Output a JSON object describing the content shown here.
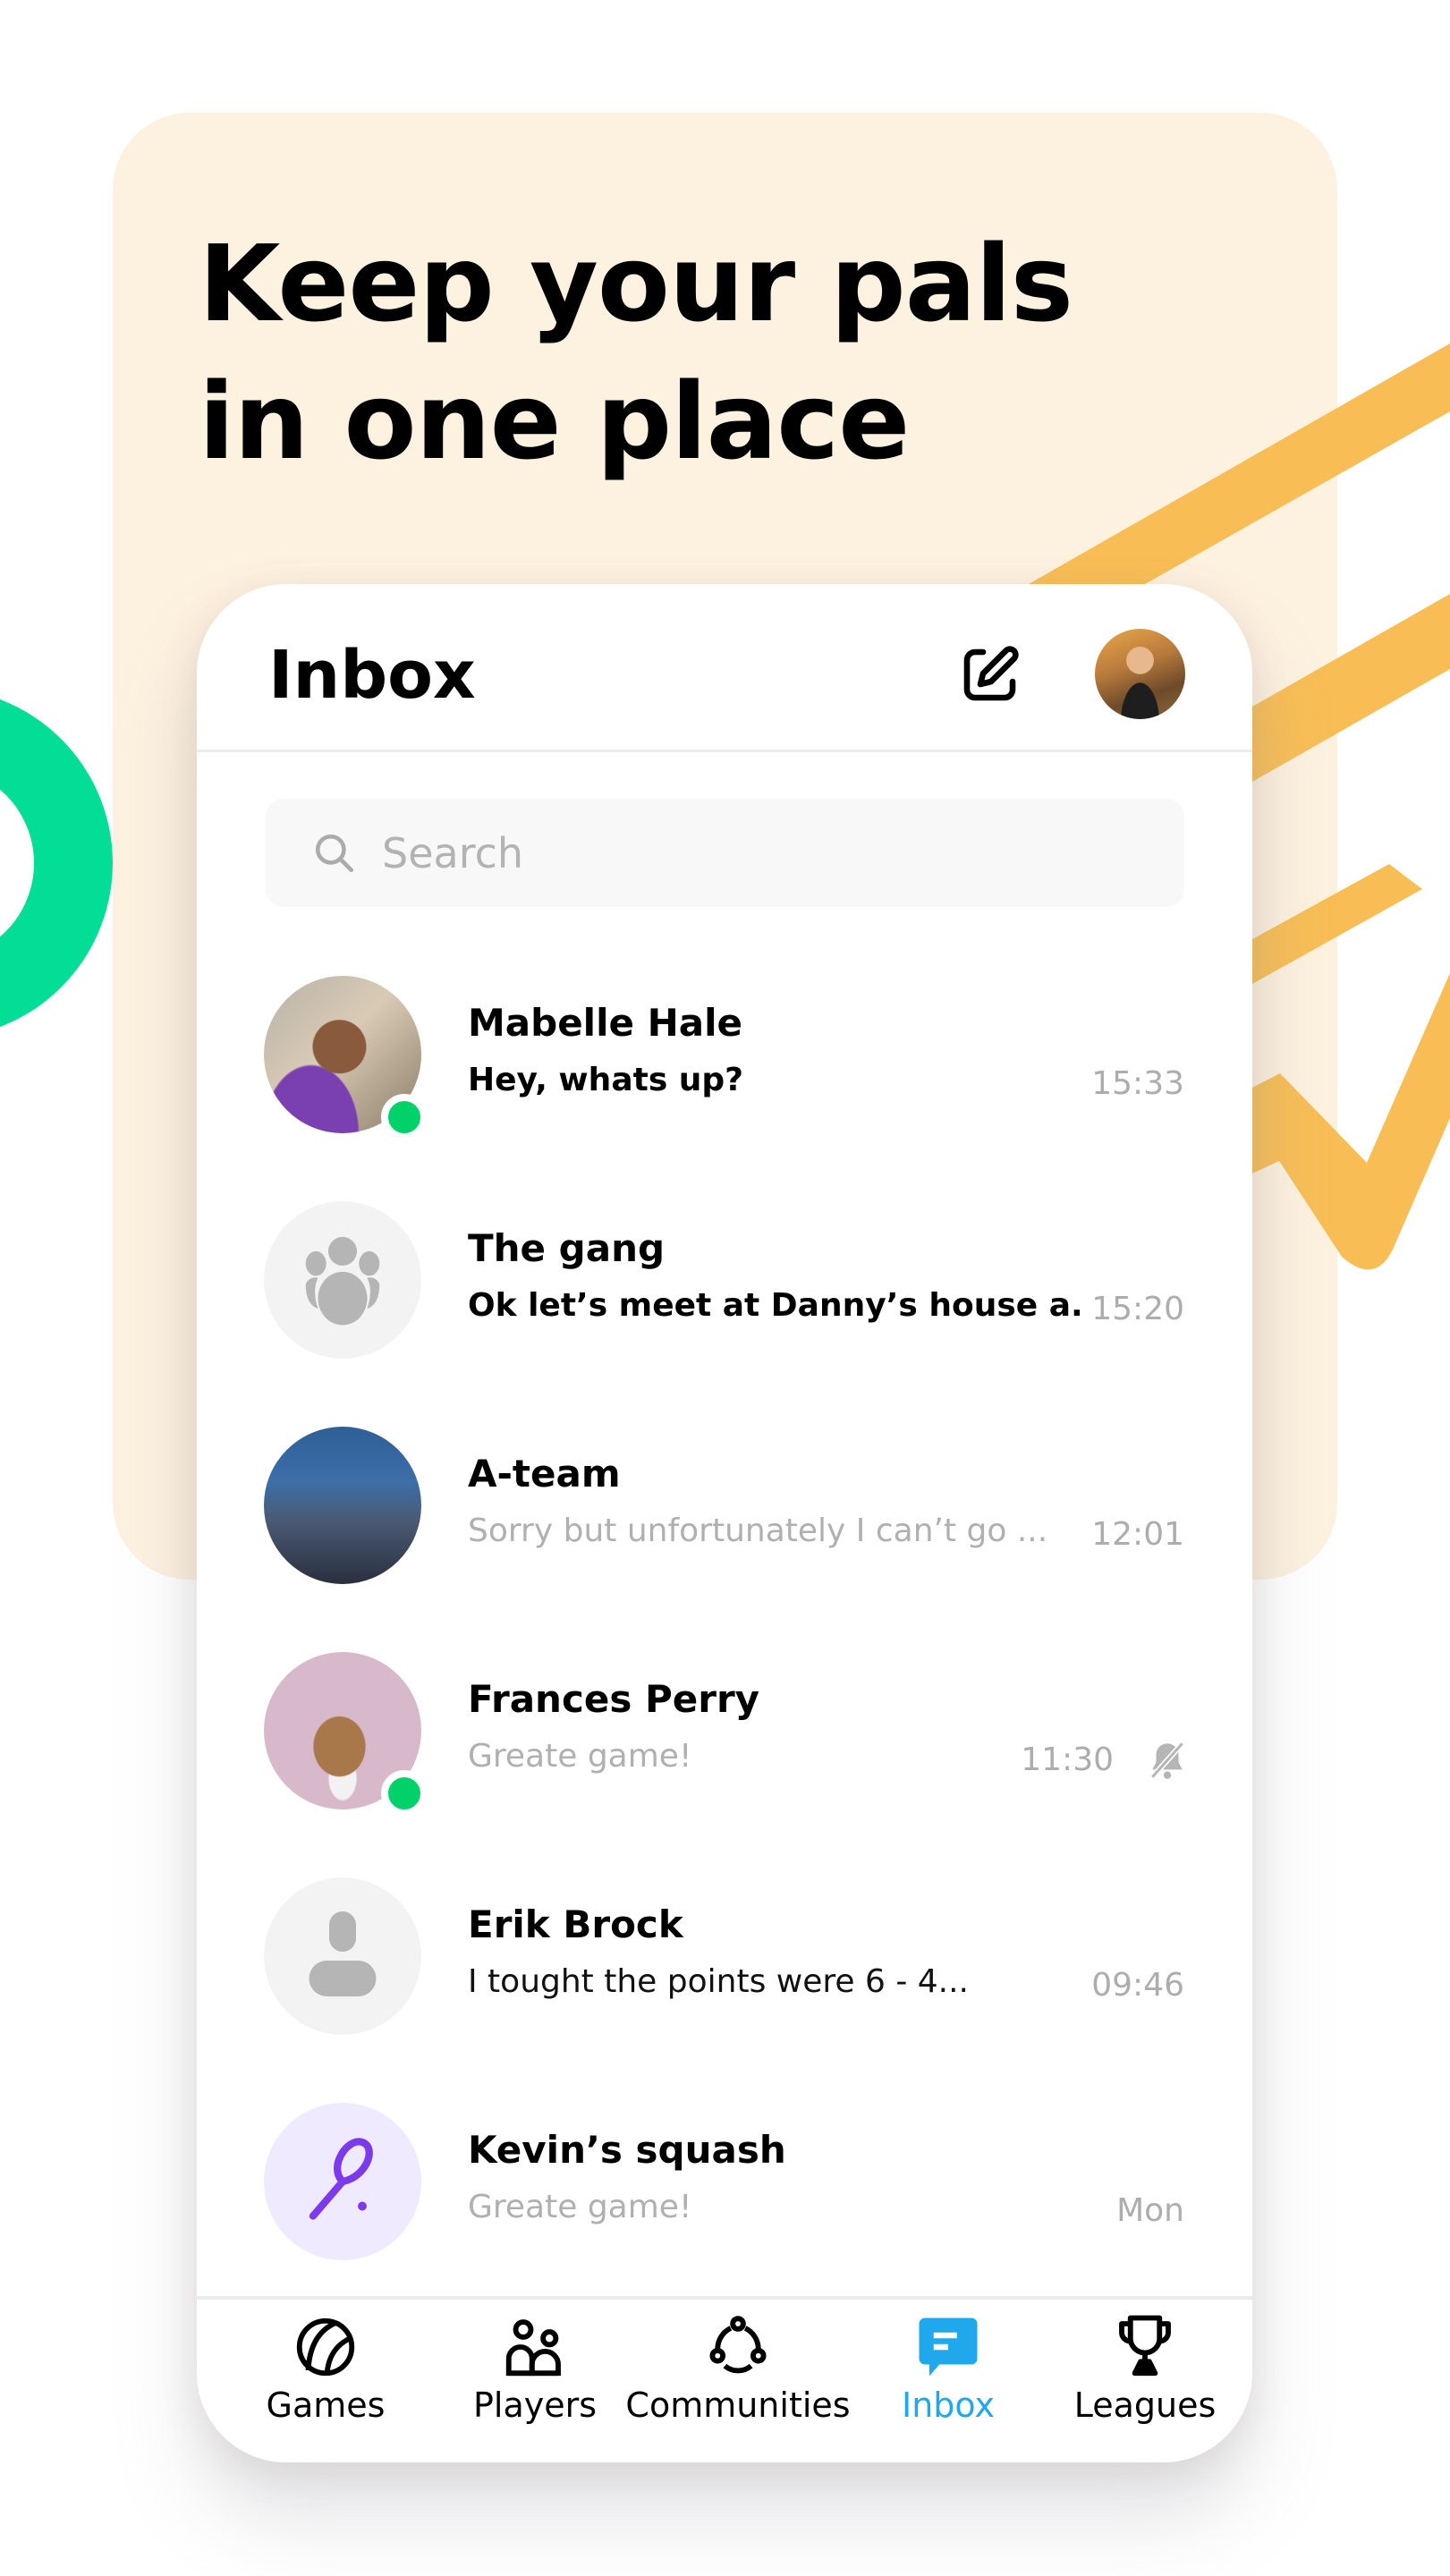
{
  "headline": {
    "line1": "Keep your pals",
    "line2": "in one place"
  },
  "colors": {
    "cream": "#FDF1DF",
    "orange_accent": "#F8BE55",
    "green_ring": "#02DE96",
    "online": "#00D26A",
    "active_tab": "#20A8EC",
    "squash_purple": "#7C3AED",
    "squash_bg": "#F0EAFE"
  },
  "header": {
    "title": "Inbox",
    "compose_icon": "edit-square-icon",
    "profile_avatar": "user-profile-photo"
  },
  "search": {
    "placeholder": "Search",
    "value": ""
  },
  "conversations": [
    {
      "name": "Mabelle Hale",
      "preview": "Hey, whats up?",
      "time": "15:33",
      "unread": true,
      "online": true,
      "avatar": "photo-woman-smiling",
      "muted": false
    },
    {
      "name": "The gang",
      "preview": "Ok let’s meet at Danny’s house a...",
      "time": "15:20",
      "unread": true,
      "online": false,
      "avatar": "group-placeholder-icon",
      "muted": false
    },
    {
      "name": "A-team",
      "preview": "Sorry but unfortunately I can’t go ...",
      "time": "12:01",
      "unread": false,
      "online": false,
      "avatar": "photo-city-skyline",
      "muted": false
    },
    {
      "name": "Frances Perry",
      "preview": "Greate game!",
      "time": "11:30",
      "unread": false,
      "online": true,
      "avatar": "photo-woman-curly-hair",
      "muted": true
    },
    {
      "name": "Erik Brock",
      "preview": "I tought the points were 6 - 4...",
      "time": "09:46",
      "unread": false,
      "online": false,
      "avatar": "person-placeholder-icon",
      "muted": false
    },
    {
      "name": "Kevin’s squash",
      "preview": "Greate game!",
      "time": "Mon",
      "unread": false,
      "online": false,
      "avatar": "squash-racket-icon",
      "muted": false
    }
  ],
  "nav": {
    "items": [
      {
        "label": "Games",
        "icon": "tennis-ball-icon",
        "active": false
      },
      {
        "label": "Players",
        "icon": "players-icon",
        "active": false
      },
      {
        "label": "Communities",
        "icon": "communities-icon",
        "active": false
      },
      {
        "label": "Inbox",
        "icon": "chat-bubble-icon",
        "active": true
      },
      {
        "label": "Leagues",
        "icon": "trophy-icon",
        "active": false
      }
    ]
  }
}
